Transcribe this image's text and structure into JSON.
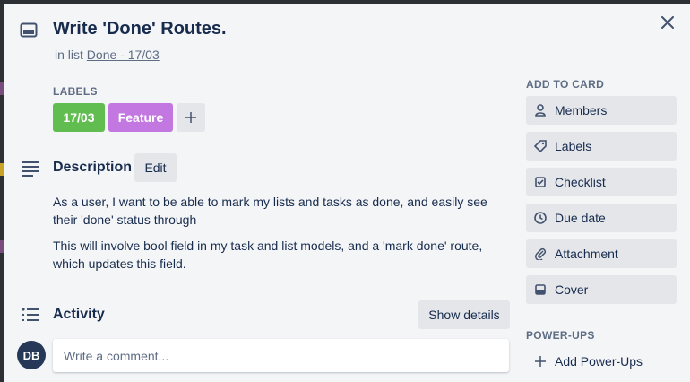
{
  "card": {
    "title": "Write 'Done' Routes.",
    "in_list_prefix": "in list",
    "list_name": "Done - 17/03",
    "close_label": "×"
  },
  "labels": {
    "heading": "LABELS",
    "items": [
      {
        "text": "17/03",
        "color": "#61bd4f"
      },
      {
        "text": "Feature",
        "color": "#c377e0"
      }
    ],
    "add_label": "+"
  },
  "description": {
    "heading": "Description",
    "edit_label": "Edit",
    "paragraphs": [
      "As a user, I want to be able to mark my lists and tasks as done, and easily see their 'done' status through",
      "This will involve bool field in my task and list models, and a 'mark done' route, which updates this field."
    ]
  },
  "activity": {
    "heading": "Activity",
    "show_details_label": "Show details",
    "avatar_initials": "DB",
    "comment_placeholder": "Write a comment..."
  },
  "sidebar": {
    "add_to_card_heading": "ADD TO CARD",
    "buttons": [
      {
        "label": "Members",
        "icon": "person-icon"
      },
      {
        "label": "Labels",
        "icon": "tag-icon"
      },
      {
        "label": "Checklist",
        "icon": "checkbox-icon"
      },
      {
        "label": "Due date",
        "icon": "clock-icon"
      },
      {
        "label": "Attachment",
        "icon": "paperclip-icon"
      },
      {
        "label": "Cover",
        "icon": "cover-icon"
      }
    ],
    "powerups_heading": "POWER-UPS",
    "add_powerups_label": "Add Power-Ups"
  }
}
